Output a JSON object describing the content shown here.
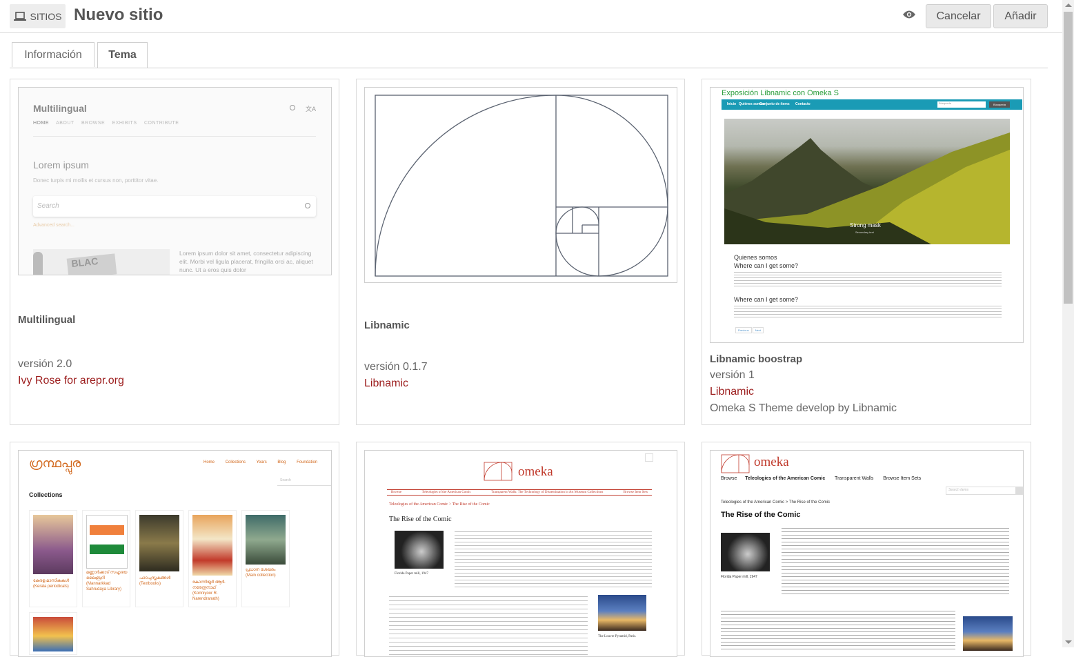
{
  "header": {
    "sites_label": "SITIOS",
    "title": "Nuevo sitio",
    "cancel_label": "Cancelar",
    "add_label": "Añadir"
  },
  "tabs": [
    {
      "label": "Información",
      "active": false
    },
    {
      "label": "Tema",
      "active": true
    }
  ],
  "themes": [
    {
      "name": "Multilingual",
      "version": "versión 2.0",
      "author": "Ivy Rose for arepr.org",
      "description": ""
    },
    {
      "name": "Libnamic",
      "version": "versión 0.1.7",
      "author": "Libnamic",
      "description": ""
    },
    {
      "name": "Libnamic boostrap",
      "version": "versión 1",
      "author": "Libnamic",
      "description": "Omeka S Theme develop by Libnamic"
    }
  ],
  "previews": {
    "multilingual": {
      "site_title": "Multilingual",
      "nav": [
        "HOME",
        "ABOUT",
        "BROWSE",
        "EXHIBITS",
        "CONTRIBUTE"
      ],
      "heading": "Lorem ipsum",
      "subtext": "Donec turpis mi mollis et cursus non, porttitor vitae.",
      "search_placeholder": "Search",
      "advanced": "Advanced search...",
      "body": "Lorem ipsum dolor sit amet, consectetur adipiscing elit. Morbi vel ligula placerat, fringilla orci ac, aliquet nunc. Ut a eros quis dolor"
    },
    "libnamic_boostrap": {
      "site_title": "Exposición Libnamic con Omeka S",
      "nav": [
        "Inicio",
        "Quiénes somos",
        "Conjunto de ítems",
        "Contacto"
      ],
      "search_placeholder": "Búsqueda",
      "search_button": "Búsqueda",
      "slide_caption": "Strong mask",
      "slide_sub": "Secondary text",
      "section1": "Quienes somos",
      "h1": "Where can I get some?",
      "h2": "Where can I get some?",
      "pager": [
        "Previous",
        "Next"
      ]
    },
    "granthappura": {
      "nav": [
        "Home",
        "Collections",
        "Years",
        "Blog",
        "Foundation"
      ],
      "search": "Search",
      "heading": "Collections",
      "items": [
        "കേരള മാസികകൾ (Kerala periodicals)",
        "മണ്ണാർക്കാട് സഹൃദയ ലൈബ്രറി (Mannarkkad Sahrudaya Library)",
        "പാഠപുസ്തകങ്ങൾ (Textbooks)",
        "കോന്നിയൂർ ആർ. നരേന്ദ്രനാഥ് (Konniyoor R. Narendranath)",
        "പ്രധാന ശേഖരം (Main collection)"
      ]
    },
    "omeka_classic": {
      "logo_text": "omeka",
      "nav": [
        "Browse",
        "Teleologies of the American Comic",
        "Transparent Walls: The Technology of Dissemination in Art Museum Collections",
        "Browse Item Sets"
      ],
      "breadcrumb": "Teleologies of the American Comic > The Rise of the Comic",
      "heading": "The Rise of the Comic",
      "caption1": "Florida Paper mill, 1947",
      "caption2": "The Louvre Pyramid, Paris."
    },
    "omeka_default": {
      "logo_text": "omeka",
      "nav": [
        "Browse",
        "Teleologies of the American Comic",
        "Transparent Walls",
        "Browse Item Sets"
      ],
      "search": "Search items",
      "breadcrumb": "Teleologies of the American Comic > The Rise of the Comic",
      "heading": "The Rise of the Comic",
      "caption1": "Florida Paper mill, 1947"
    }
  }
}
